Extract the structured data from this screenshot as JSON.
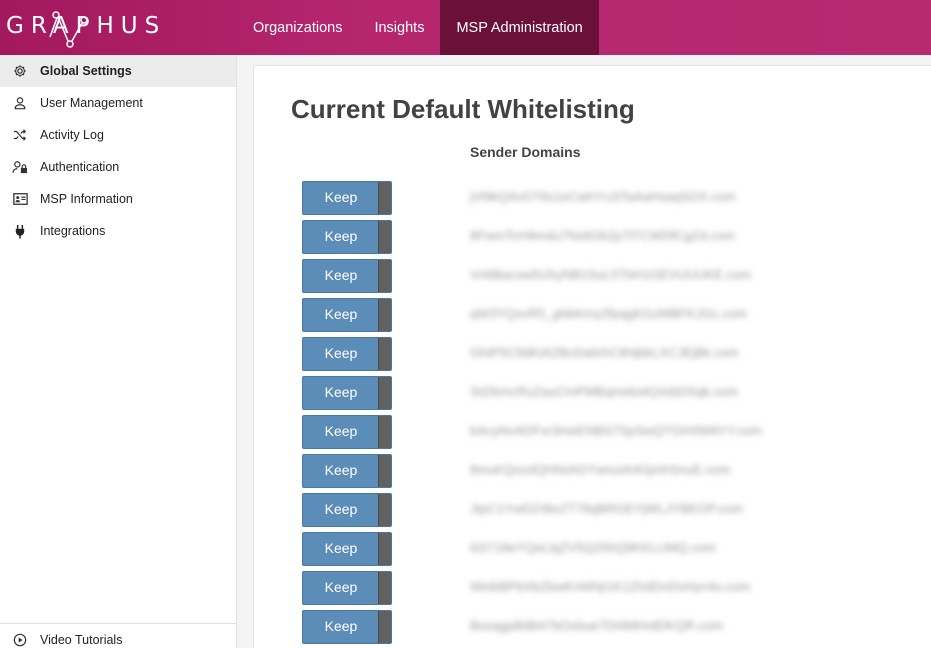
{
  "header": {
    "logo_text": "GRAPHUS",
    "nav": [
      {
        "label": "Organizations"
      },
      {
        "label": "Insights"
      },
      {
        "label": "MSP Administration"
      }
    ],
    "active_nav": "MSP Administration"
  },
  "sidebar": {
    "items": [
      {
        "label": "Global Settings",
        "icon": "gear-icon"
      },
      {
        "label": "User Management",
        "icon": "user-icon"
      },
      {
        "label": "Activity Log",
        "icon": "shuffle-icon"
      },
      {
        "label": "Authentication",
        "icon": "user-lock-icon"
      },
      {
        "label": "MSP Information",
        "icon": "id-card-icon"
      },
      {
        "label": "Integrations",
        "icon": "plug-icon"
      }
    ],
    "footer_item": {
      "label": "Video Tutorials",
      "icon": "play-circle-icon"
    }
  },
  "main": {
    "title": "Current Default Whitelisting",
    "column_header": "Sender Domains",
    "keep_label": "Keep",
    "rows": [
      {
        "domain": "jVl9kQ4vGT6s1eCwhYc2tTaAaHsaqSOX.com"
      },
      {
        "domain": "8FwmTcH9mdu7Ns6Gk2p7tTCWDfCgZd.com"
      },
      {
        "domain": "Vn6Bacow5UhyNB1SuL5TbH1GEVUUUKE.com"
      },
      {
        "domain": "qW3YQsvR5_gNkKmy2fpqgKGzMBFKJGc.com"
      },
      {
        "domain": "GhtP5C9dKiAZBcDa6rhC9HjbkLXCJEjBk.com"
      },
      {
        "domain": "3sDkmcRuZauCmPMBqmeboKjVobDSqk.com"
      },
      {
        "domain": "bAcyNvADFxr3meENBS7SpSwQTGIHIWAYY.com"
      },
      {
        "domain": "8muKQozdQHNsN2YwnuIA4GjmhSnuE.com"
      },
      {
        "domain": "JtpC1YwDZrBeZT78qBRGEYjWLJYBEOP.com"
      },
      {
        "domain": "62i718eYQeLbjZV5Q25hQ9KKLUMQ.com"
      },
      {
        "domain": "WeibBPbXbZbwKnWhjI1K1ZhdDnDsHyn4u.com"
      },
      {
        "domain": "BosqgpBIBt47bOxbue7Di4MHrdDKQR.com"
      }
    ]
  },
  "colors": {
    "header_bg": "#b5266f",
    "nav_active_bg": "#6b1039",
    "keep_button": "#5b8db8",
    "keep_toggle": "#616161"
  }
}
